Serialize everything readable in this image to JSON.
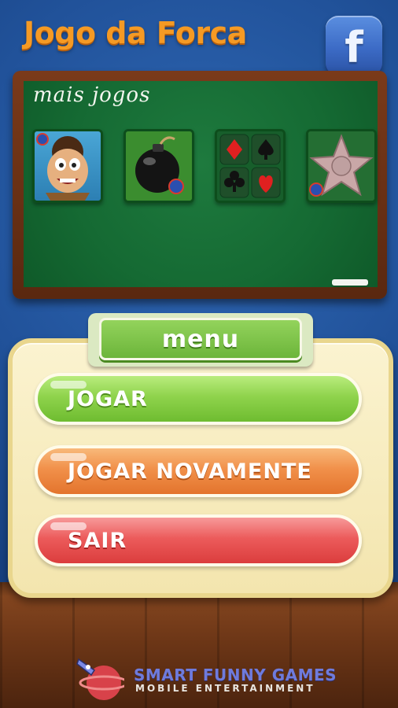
{
  "header": {
    "title": "Jogo da Forca",
    "facebook_label": "f",
    "facebook_icon": "facebook-icon"
  },
  "chalkboard": {
    "label": "mais jogos",
    "games": [
      {
        "icon": "caveman-game-icon"
      },
      {
        "icon": "bomb-game-icon"
      },
      {
        "icon": "card-suits-game-icon"
      },
      {
        "icon": "star-game-icon"
      }
    ]
  },
  "menu": {
    "title": "menu",
    "buttons": {
      "play": "JOGAR",
      "replay": "JOGAR NOVAMENTE",
      "exit": "SAIR"
    }
  },
  "footer": {
    "brand": "SMART FUNNY GAMES",
    "tagline": "MOBILE ENTERTAINMENT",
    "logo_icon": "rocket-planet-icon"
  },
  "colors": {
    "title_orange": "#f59a24",
    "wall_blue": "#21529a",
    "board_green": "#156a33",
    "button_green": "#8fd34c",
    "button_orange": "#f1904a",
    "button_red": "#ec5b5b"
  }
}
